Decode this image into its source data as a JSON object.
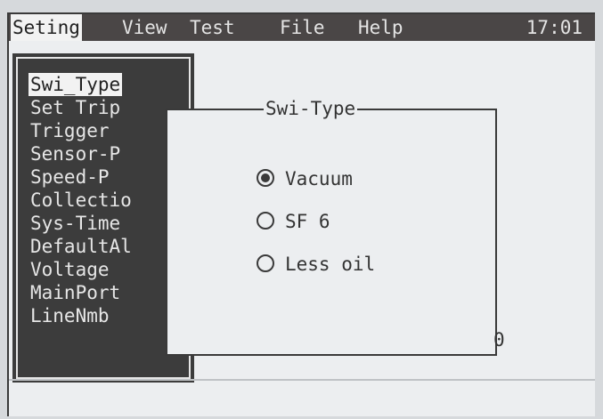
{
  "menubar": {
    "items": [
      "Seting",
      "View",
      "Test",
      "File",
      "Help"
    ],
    "active": "Seting",
    "clock": "17:01"
  },
  "side_menu": {
    "items": [
      "Swi_Type",
      "Set Trip",
      "Trigger",
      "Sensor-P",
      "Speed-P",
      "Collectio",
      "Sys-Time",
      "DefaultAl",
      "Voltage",
      "MainPort",
      "LineNmb"
    ],
    "selected": "Swi_Type"
  },
  "dialog": {
    "title": "Swi-Type",
    "options": [
      {
        "label": "Vacuum",
        "checked": true
      },
      {
        "label": "SF 6",
        "checked": false
      },
      {
        "label": "Less oil",
        "checked": false
      }
    ]
  },
  "stray_text": "0"
}
